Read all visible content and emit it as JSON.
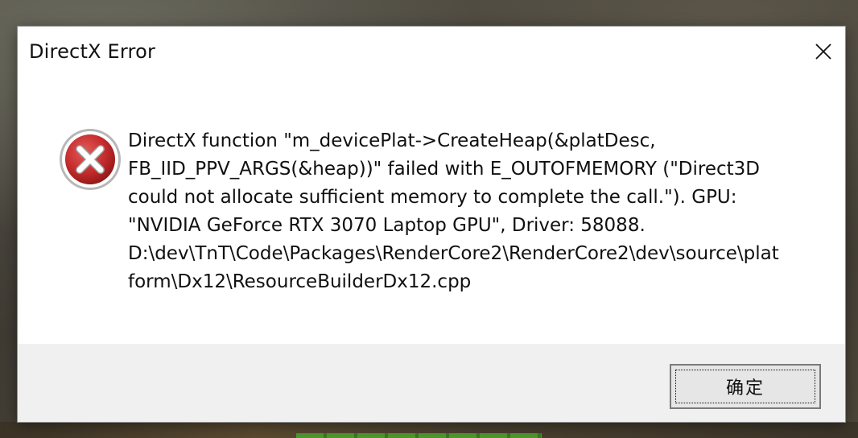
{
  "window": {
    "title": "DirectX Error"
  },
  "message": {
    "text": "DirectX function \"m_devicePlat->CreateHeap(&platDesc,\nFB_IID_PPV_ARGS(&heap))\" failed with E_OUTOFMEMORY (\"Direct3D\ncould not allocate sufficient memory to complete the call.\"). GPU:\n\"NVIDIA GeForce RTX 3070 Laptop GPU\", Driver: 58088.\nD:\\dev\\TnT\\Code\\Packages\\RenderCore2\\RenderCore2\\dev\\source\\plat\nform\\Dx12\\ResourceBuilderDx12.cpp"
  },
  "buttons": {
    "ok_label": "确定"
  },
  "icons": {
    "error": "error-icon",
    "close": "close-icon"
  },
  "colors": {
    "error_red": "#c42b2b",
    "footer_bg": "#f0f0f0"
  }
}
